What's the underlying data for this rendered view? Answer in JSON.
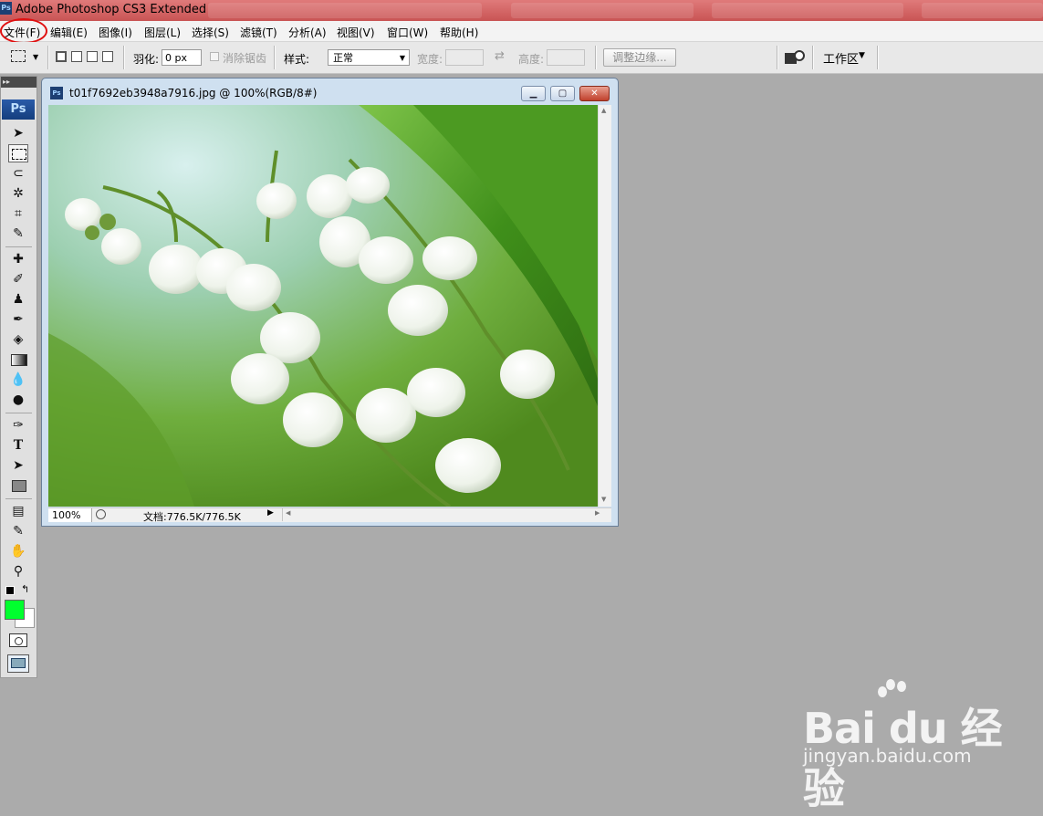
{
  "window": {
    "title": "Adobe Photoshop CS3 Extended",
    "app_icon": "Ps"
  },
  "menu": {
    "items": [
      "文件(F)",
      "编辑(E)",
      "图像(I)",
      "图层(L)",
      "选择(S)",
      "滤镜(T)",
      "分析(A)",
      "视图(V)",
      "窗口(W)",
      "帮助(H)"
    ]
  },
  "options": {
    "feather_label": "羽化:",
    "feather_value": "0 px",
    "antialias_label": "消除锯齿",
    "style_label": "样式:",
    "style_value": "正常",
    "width_label": "宽度:",
    "height_label": "高度:",
    "refine_edge_label": "调整边缘...",
    "workspace_label": "工作区"
  },
  "toolbox": {
    "badge": "Ps",
    "foreground_color": "#00ff2e",
    "background_color": "#ffffff"
  },
  "document": {
    "title": "t01f7692eb3948a7916.jpg @ 100%(RGB/8#)",
    "zoom": "100%",
    "doc_info": "文档:776.5K/776.5K"
  },
  "watermark": {
    "brand": "Bai du 经验",
    "url": "jingyan.baidu.com"
  }
}
